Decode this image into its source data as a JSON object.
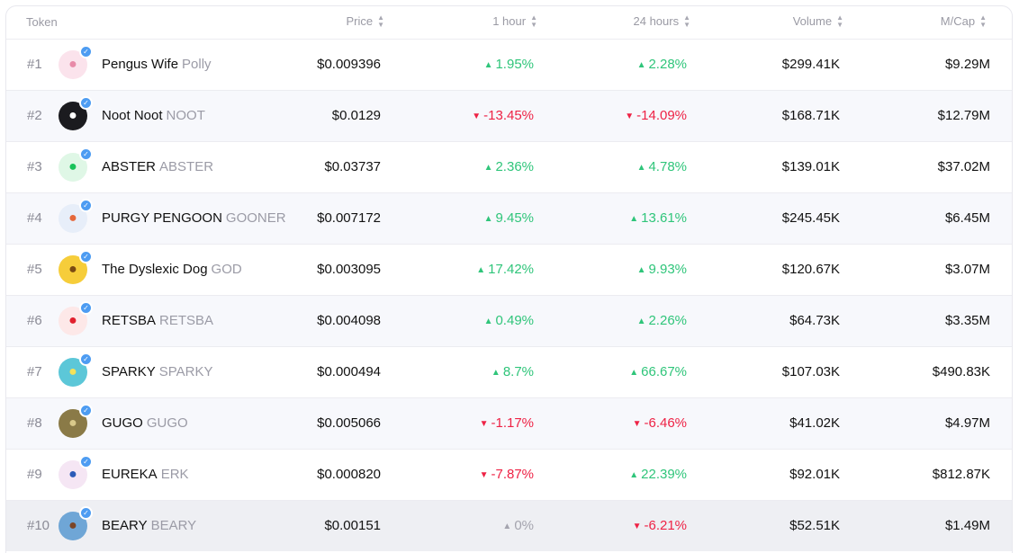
{
  "header": {
    "token": "Token",
    "price": "Price",
    "hour1": "1 hour",
    "hour24": "24 hours",
    "volume": "Volume",
    "mcap": "M/Cap",
    "sort_icon": "sort-icon"
  },
  "colors": {
    "up": "#2fc57a",
    "down": "#ee2245",
    "flat": "#a4a4ae",
    "verified": "#4d9cf2"
  },
  "rows": [
    {
      "rank": "#1",
      "name": "Pengus Wife",
      "symbol": "Polly",
      "price": "$0.009396",
      "h1": "1.95%",
      "h1_dir": "up",
      "h24": "2.28%",
      "h24_dir": "up",
      "volume": "$299.41K",
      "mcap": "$9.29M",
      "avatar_bg": "#fbe3ec",
      "avatar_fg": "#e88aa8",
      "avatar_icon": "penguin-icon"
    },
    {
      "rank": "#2",
      "name": "Noot Noot",
      "symbol": "NOOT",
      "price": "$0.0129",
      "h1": "-13.45%",
      "h1_dir": "down",
      "h24": "-14.09%",
      "h24_dir": "down",
      "volume": "$168.71K",
      "mcap": "$12.79M",
      "avatar_bg": "#1b1b1f",
      "avatar_fg": "#ffffff",
      "avatar_icon": "penguin-icon"
    },
    {
      "rank": "#3",
      "name": "ABSTER",
      "symbol": "ABSTER",
      "price": "$0.03737",
      "h1": "2.36%",
      "h1_dir": "up",
      "h24": "4.78%",
      "h24_dir": "up",
      "volume": "$139.01K",
      "mcap": "$37.02M",
      "avatar_bg": "#dff7e6",
      "avatar_fg": "#18c25a",
      "avatar_icon": "penguin-icon"
    },
    {
      "rank": "#4",
      "name": "PURGY PENGOON",
      "symbol": "GOONER",
      "price": "$0.007172",
      "h1": "9.45%",
      "h1_dir": "up",
      "h24": "13.61%",
      "h24_dir": "up",
      "volume": "$245.45K",
      "mcap": "$6.45M",
      "avatar_bg": "#e7eef9",
      "avatar_fg": "#e5683b",
      "avatar_icon": "penguin-icon"
    },
    {
      "rank": "#5",
      "name": "The Dyslexic Dog",
      "symbol": "GOD",
      "price": "$0.003095",
      "h1": "17.42%",
      "h1_dir": "up",
      "h24": "9.93%",
      "h24_dir": "up",
      "volume": "$120.67K",
      "mcap": "$3.07M",
      "avatar_bg": "#f6cd3a",
      "avatar_fg": "#7a4a12",
      "avatar_icon": "dog-icon"
    },
    {
      "rank": "#6",
      "name": "RETSBA",
      "symbol": "RETSBA",
      "price": "$0.004098",
      "h1": "0.49%",
      "h1_dir": "up",
      "h24": "2.26%",
      "h24_dir": "up",
      "volume": "$64.73K",
      "mcap": "$3.35M",
      "avatar_bg": "#fde8e8",
      "avatar_fg": "#e1202e",
      "avatar_icon": "penguin-icon"
    },
    {
      "rank": "#7",
      "name": "SPARKY",
      "symbol": "SPARKY",
      "price": "$0.000494",
      "h1": "8.7%",
      "h1_dir": "up",
      "h24": "66.67%",
      "h24_dir": "up",
      "volume": "$107.03K",
      "mcap": "$490.83K",
      "avatar_bg": "#5cc7d8",
      "avatar_fg": "#f4e25a",
      "avatar_icon": "sparkle-icon"
    },
    {
      "rank": "#8",
      "name": "GUGO",
      "symbol": "GUGO",
      "price": "$0.005066",
      "h1": "-1.17%",
      "h1_dir": "down",
      "h24": "-6.46%",
      "h24_dir": "down",
      "volume": "$41.02K",
      "mcap": "$4.97M",
      "avatar_bg": "#8a7a47",
      "avatar_fg": "#d9c98a",
      "avatar_icon": "character-icon"
    },
    {
      "rank": "#9",
      "name": "EUREKA",
      "symbol": "ERK",
      "price": "$0.000820",
      "h1": "-7.87%",
      "h1_dir": "down",
      "h24": "22.39%",
      "h24_dir": "up",
      "volume": "$92.01K",
      "mcap": "$812.87K",
      "avatar_bg": "#f5e6f4",
      "avatar_fg": "#2b5bb8",
      "avatar_icon": "penguin-icon"
    },
    {
      "rank": "#10",
      "name": "BEARY",
      "symbol": "BEARY",
      "price": "$0.00151",
      "h1": "0%",
      "h1_dir": "flat",
      "h24": "-6.21%",
      "h24_dir": "down",
      "volume": "$52.51K",
      "mcap": "$1.49M",
      "avatar_bg": "#6fa6d6",
      "avatar_fg": "#7b4527",
      "avatar_icon": "bear-icon"
    }
  ]
}
